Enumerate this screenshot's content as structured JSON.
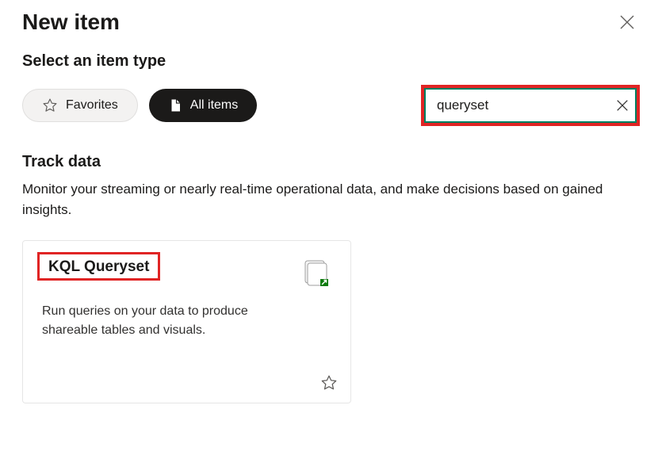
{
  "header": {
    "title": "New item"
  },
  "subtitle": "Select an item type",
  "filter": {
    "favorites_label": "Favorites",
    "all_items_label": "All items",
    "search_value": "queryset"
  },
  "section": {
    "title": "Track data",
    "description": "Monitor your streaming or nearly real-time operational data, and make decisions based on gained insights."
  },
  "card": {
    "title": "KQL Queryset",
    "description": "Run queries on your data to produce shareable tables and visuals."
  }
}
